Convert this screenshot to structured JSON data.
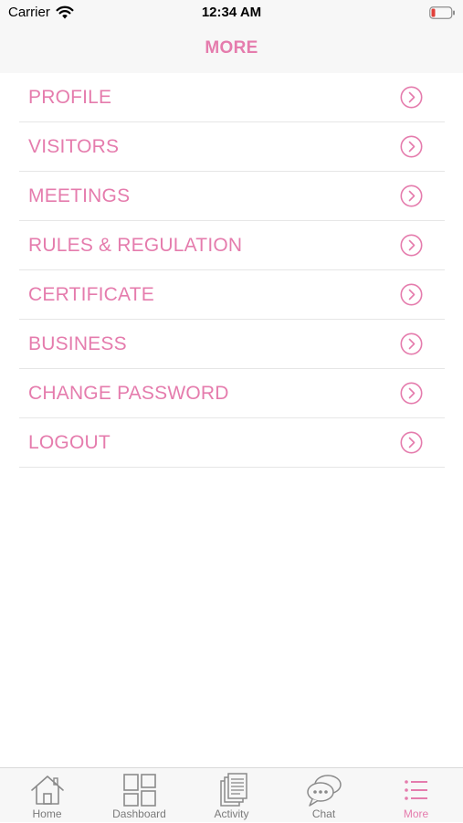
{
  "status_bar": {
    "carrier": "Carrier",
    "time": "12:34 AM"
  },
  "nav": {
    "title": "MORE"
  },
  "menu": {
    "items": [
      {
        "label": "PROFILE"
      },
      {
        "label": "VISITORS"
      },
      {
        "label": "MEETINGS"
      },
      {
        "label": "RULES & REGULATION"
      },
      {
        "label": "CERTIFICATE"
      },
      {
        "label": "BUSINESS"
      },
      {
        "label": "CHANGE PASSWORD"
      },
      {
        "label": "LOGOUT"
      }
    ]
  },
  "tab_bar": {
    "tabs": [
      {
        "label": "Home",
        "icon": "home-icon"
      },
      {
        "label": "Dashboard",
        "icon": "dashboard-icon"
      },
      {
        "label": "Activity",
        "icon": "activity-icon"
      },
      {
        "label": "Chat",
        "icon": "chat-icon"
      },
      {
        "label": "More",
        "icon": "more-icon",
        "active": true
      }
    ]
  },
  "colors": {
    "accent": "#e57cad",
    "bar_background": "#f7f7f7",
    "inactive_tab": "#7a7a7a",
    "battery_low": "#e0403a"
  }
}
